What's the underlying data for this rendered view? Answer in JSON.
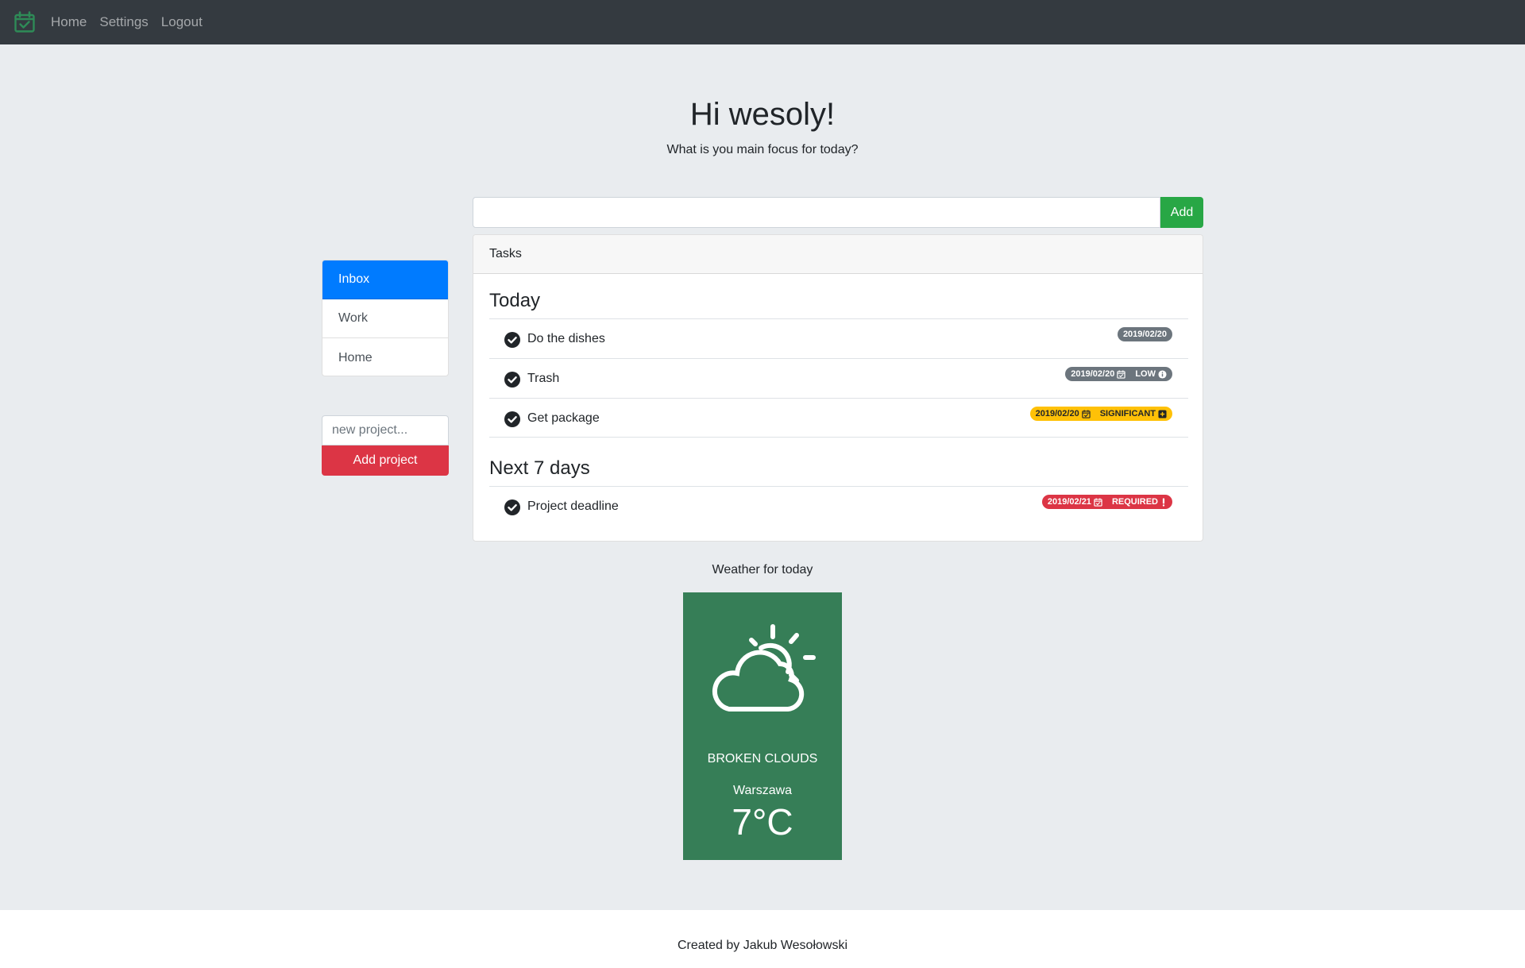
{
  "nav": {
    "brand_icon": "calendar-check-icon",
    "links": [
      "Home",
      "Settings",
      "Logout"
    ]
  },
  "hero": {
    "title": "Hi wesoly!",
    "subtitle": "What is you main focus for today?"
  },
  "task_input": {
    "value": "",
    "add_label": "Add"
  },
  "tasks_card": {
    "header": "Tasks",
    "sections": [
      {
        "title": "Today",
        "tasks": [
          {
            "text": "Do the dishes",
            "date": "2019/02/20",
            "priority": ""
          },
          {
            "text": "Trash",
            "date": "2019/02/20",
            "priority": "LOW"
          },
          {
            "text": "Get package",
            "date": "2019/02/20",
            "priority": "SIGNIFICANT"
          }
        ]
      },
      {
        "title": "Next 7 days",
        "tasks": [
          {
            "text": "Project deadline",
            "date": "2019/02/21",
            "priority": "REQUIRED"
          }
        ]
      }
    ]
  },
  "projects": {
    "items": [
      "Inbox",
      "Work",
      "Home"
    ],
    "active": "Inbox",
    "new_project_placeholder": "new project...",
    "add_label": "Add project"
  },
  "weather": {
    "label": "Weather for today",
    "icon": "partly-cloudy-icon",
    "description": "BROKEN CLOUDS",
    "city": "Warszawa",
    "temperature": "7°C"
  },
  "footer": {
    "text": "Created by Jakub Wesołowski"
  },
  "colors": {
    "navbar": "#343a40",
    "primary": "#007bff",
    "success": "#28a745",
    "danger": "#dc3545",
    "warning": "#ffc107",
    "secondary": "#6c757d",
    "weather_bg": "#367e57"
  }
}
